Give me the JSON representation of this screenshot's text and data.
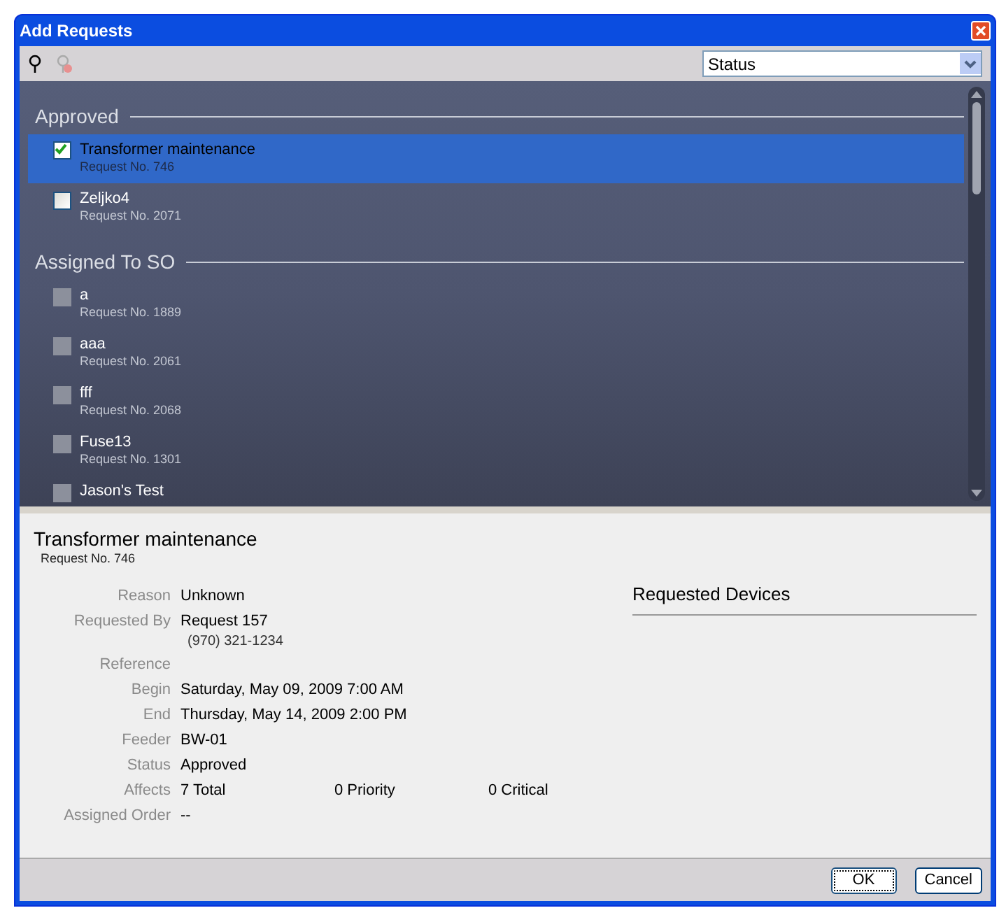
{
  "window": {
    "title": "Add Requests"
  },
  "toolbar": {
    "sort_select": {
      "value": "Status"
    }
  },
  "groups": [
    {
      "title": "Approved",
      "items": [
        {
          "name": "Transformer maintenance",
          "number": "Request No. 746",
          "checked": true,
          "disabled": false,
          "selected": true
        },
        {
          "name": "Zeljko4",
          "number": "Request No. 2071",
          "checked": false,
          "disabled": false,
          "selected": false
        }
      ]
    },
    {
      "title": "Assigned To SO",
      "items": [
        {
          "name": "a",
          "number": "Request No. 1889",
          "checked": false,
          "disabled": true,
          "selected": false
        },
        {
          "name": "aaa",
          "number": "Request No. 2061",
          "checked": false,
          "disabled": true,
          "selected": false
        },
        {
          "name": "fff",
          "number": "Request No. 2068",
          "checked": false,
          "disabled": true,
          "selected": false
        },
        {
          "name": "Fuse13",
          "number": "Request No. 1301",
          "checked": false,
          "disabled": true,
          "selected": false
        },
        {
          "name": "Jason's Test",
          "checked": false,
          "disabled": true,
          "selected": false
        }
      ]
    }
  ],
  "details": {
    "title": "Transformer maintenance",
    "number": "Request No. 746",
    "fields": [
      {
        "label": "Reason",
        "values": [
          "Unknown"
        ]
      },
      {
        "label": "Requested By",
        "values": [
          "Request 157"
        ],
        "sub": "(970) 321-1234"
      },
      {
        "label": "Reference"
      },
      {
        "label": "Begin",
        "values": [
          "Saturday, May 09, 2009 7:00 AM"
        ]
      },
      {
        "label": "End",
        "values": [
          "Thursday, May 14, 2009 2:00 PM"
        ]
      },
      {
        "label": "Feeder",
        "values": [
          "BW-01"
        ]
      },
      {
        "label": "Status",
        "values": [
          "Approved"
        ]
      },
      {
        "label": "Affects",
        "values": [
          "7 Total",
          "0 Priority",
          "0 Critical"
        ]
      },
      {
        "label": "Assigned Order",
        "values": [
          "--"
        ]
      }
    ],
    "devices_title": "Requested Devices"
  },
  "buttons": [
    {
      "label": "OK",
      "focused": true
    },
    {
      "label": "Cancel",
      "focused": false
    }
  ]
}
